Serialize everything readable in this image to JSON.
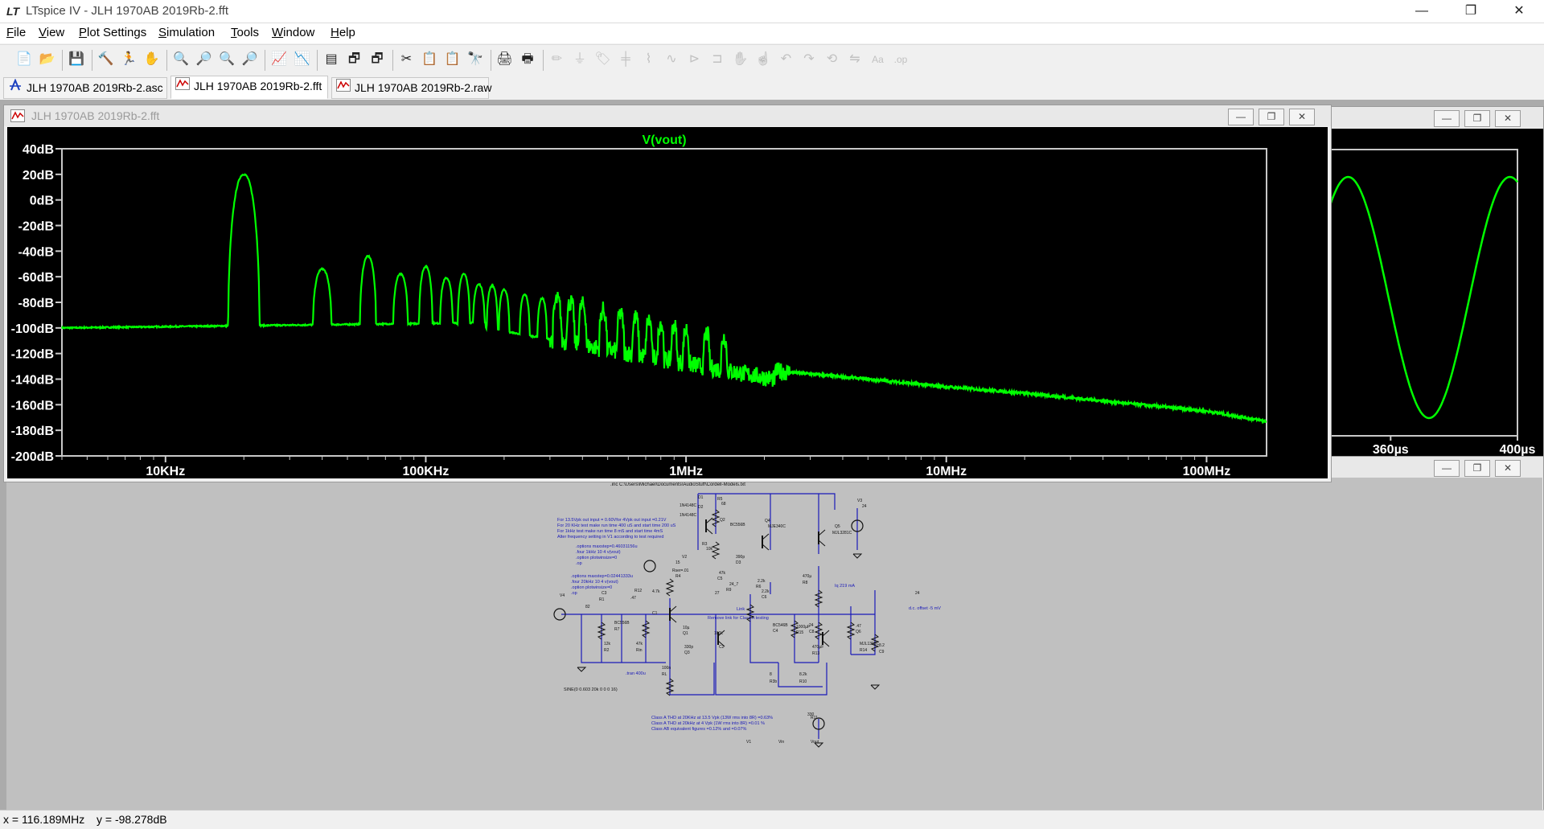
{
  "app": {
    "title": "LTspice IV - JLH 1970AB 2019Rb-2.fft",
    "logo_text": "LT",
    "window_controls": [
      "minimize",
      "restore",
      "close"
    ]
  },
  "menu": [
    {
      "label": "File",
      "underline": "F"
    },
    {
      "label": "View",
      "underline": "V"
    },
    {
      "label": "Plot Settings",
      "underline": "P"
    },
    {
      "label": "Simulation",
      "underline": "S"
    },
    {
      "label": "Tools",
      "underline": "T"
    },
    {
      "label": "Window",
      "underline": "W"
    },
    {
      "label": "Help",
      "underline": "H"
    }
  ],
  "toolbar": [
    {
      "icon": "new-schematic-icon",
      "glyph": "📄"
    },
    {
      "icon": "open-icon",
      "glyph": "📂"
    },
    {
      "sep": true
    },
    {
      "icon": "save-icon",
      "glyph": "💾"
    },
    {
      "sep": true
    },
    {
      "icon": "control-panel-icon",
      "glyph": "🔨"
    },
    {
      "icon": "run-icon",
      "glyph": "🏃"
    },
    {
      "icon": "pan-icon",
      "glyph": "✋"
    },
    {
      "sep": true
    },
    {
      "icon": "zoom-in-icon",
      "glyph": "🔍"
    },
    {
      "icon": "zoom-out-icon",
      "glyph": "🔎"
    },
    {
      "icon": "zoom-extents-icon",
      "glyph": "🔍"
    },
    {
      "icon": "zoom-cancel-icon",
      "glyph": "🔎"
    },
    {
      "sep": true
    },
    {
      "icon": "autorange-icon",
      "glyph": "📈"
    },
    {
      "icon": "probe-icon",
      "glyph": "📉"
    },
    {
      "sep": true
    },
    {
      "icon": "tile-horizontal-icon",
      "glyph": "▤"
    },
    {
      "icon": "cascade-icon",
      "glyph": "🗗"
    },
    {
      "icon": "tile-vertical-icon",
      "glyph": "🗗"
    },
    {
      "sep": true
    },
    {
      "icon": "cut-icon",
      "glyph": "✂"
    },
    {
      "icon": "copy-icon",
      "glyph": "📋"
    },
    {
      "icon": "paste-icon",
      "glyph": "📋"
    },
    {
      "icon": "find-icon",
      "glyph": "🔭"
    },
    {
      "sep": true
    },
    {
      "icon": "print-preview-icon",
      "glyph": "🖨"
    },
    {
      "icon": "print-icon",
      "glyph": "🖶"
    },
    {
      "sep": true
    },
    {
      "icon": "draw-wire-icon",
      "glyph": "✏"
    },
    {
      "icon": "ground-icon",
      "glyph": "⏚"
    },
    {
      "icon": "label-net-icon",
      "glyph": "🏷"
    },
    {
      "icon": "capacitor-icon",
      "glyph": "╪"
    },
    {
      "icon": "resistor-icon",
      "glyph": "⌇"
    },
    {
      "icon": "inductor-icon",
      "glyph": "∿"
    },
    {
      "icon": "diode-icon",
      "glyph": "⊳"
    },
    {
      "icon": "component-icon",
      "glyph": "⊐"
    },
    {
      "icon": "move-icon",
      "glyph": "✋"
    },
    {
      "icon": "drag-icon",
      "glyph": "☝"
    },
    {
      "icon": "undo-icon",
      "glyph": "↶"
    },
    {
      "icon": "redo-icon",
      "glyph": "↷"
    },
    {
      "icon": "rotate-icon",
      "glyph": "⟲"
    },
    {
      "icon": "mirror-icon",
      "glyph": "⇋"
    },
    {
      "icon": "text-icon",
      "glyph": "Aa"
    },
    {
      "icon": "spice-directive-icon",
      "glyph": ".op"
    }
  ],
  "tabs": [
    {
      "label": "JLH 1970AB 2019Rb-2.asc",
      "icon": "schematic-icon",
      "active": false
    },
    {
      "label": "JLH 1970AB 2019Rb-2.fft",
      "icon": "waveform-icon",
      "active": true
    },
    {
      "label": "JLH 1970AB 2019Rb-2.raw",
      "icon": "waveform-icon",
      "active": false
    }
  ],
  "fft_window": {
    "title": "JLH 1970AB 2019Rb-2.fft",
    "colors": {
      "trace": "#00ff00",
      "bg": "#000000",
      "axis": "#ffffff"
    }
  },
  "chart_data": [
    {
      "type": "line",
      "title": "V(vout)",
      "xlabel": "",
      "ylabel": "",
      "xscale": "log",
      "xlim": [
        4000,
        170000000
      ],
      "ylim": [
        -200,
        40
      ],
      "grid": false,
      "y_ticks": [
        "40dB",
        "20dB",
        "0dB",
        "-20dB",
        "-40dB",
        "-60dB",
        "-80dB",
        "-100dB",
        "-120dB",
        "-140dB",
        "-160dB",
        "-180dB",
        "-200dB"
      ],
      "x_ticks": [
        "10KHz",
        "100KHz",
        "1MHz",
        "10MHz",
        "100MHz"
      ],
      "series": [
        {
          "color": "#00ff00",
          "x": [
            4000,
            8000,
            15000,
            17000,
            20000,
            23000,
            26000,
            40000,
            60000,
            80000,
            100000,
            120000,
            140000,
            160000,
            180000,
            200000,
            300000,
            400000,
            600000,
            800000,
            1000000,
            1500000,
            2000000,
            3000000,
            5000000,
            10000000,
            20000000,
            50000000,
            100000000,
            170000000
          ],
          "values": [
            -102,
            -100,
            -97,
            15,
            20,
            15,
            -97,
            -56,
            -46,
            -62,
            -53,
            -65,
            -62,
            -71,
            -73,
            -75,
            -82,
            -88,
            -98,
            -102,
            -110,
            -125,
            -133,
            -136,
            -140,
            -146,
            -151,
            -159,
            -165,
            -173
          ],
          "peaks": [
            [
              20000,
              20
            ],
            [
              40000,
              -54
            ],
            [
              60000,
              -44
            ],
            [
              80000,
              -58
            ],
            [
              100000,
              -52
            ],
            [
              120000,
              -61
            ],
            [
              140000,
              -58
            ],
            [
              160000,
              -66
            ],
            [
              180000,
              -67
            ],
            [
              200000,
              -70
            ],
            [
              240000,
              -74
            ],
            [
              280000,
              -77
            ],
            [
              320000,
              -78
            ],
            [
              360000,
              -80
            ],
            [
              400000,
              -82
            ],
            [
              480000,
              -86
            ],
            [
              560000,
              -89
            ],
            [
              640000,
              -92
            ],
            [
              720000,
              -94
            ],
            [
              800000,
              -96
            ],
            [
              900000,
              -98
            ],
            [
              1000000,
              -101
            ],
            [
              1200000,
              -104
            ],
            [
              1400000,
              -107
            ]
          ]
        }
      ]
    },
    {
      "type": "line",
      "title": "",
      "xlabel": "",
      "ylabel": "",
      "xlim": [
        330,
        400
      ],
      "x_ticks": [
        "360µs",
        "400µs"
      ],
      "series": [
        {
          "color": "#00ff00",
          "x": [
            334,
            340,
            350,
            359,
            368,
            378,
            387,
            396,
            400
          ],
          "values": [
            0.0,
            0.55,
            0.97,
            1.0,
            0.55,
            -0.45,
            -0.98,
            -0.6,
            -0.1
          ]
        }
      ]
    }
  ],
  "schematic": {
    "title_line": ".inc C:\\Users\\Michael\\Documents\\AudioStuff\\Cordell-Models.txt",
    "notes": [
      "For 13.5Vpk out input = 0.60Vfor 4Vpk out input =0.21V",
      "For 20 KHz test make run time 400 uS and start time 200 uS",
      "For 1kHz test make run time 8 mS and start time 4mS",
      "Alter frequency setting in V1 according to test required",
      ".options maxstep=0.46031156u",
      ".four 1kHz 10 4 v(vout)",
      ".option plotwinsize=0",
      ".op",
      ".options maxstep=0.02441333u",
      ".four 20kHz 10 4 v(vout)",
      ".option plotwinsize=0",
      ".op",
      ".tran 400u",
      "SINE(0 0.603 20k 0 0 0 16)",
      "Remove link for Class A testing",
      "Link",
      "Iq 219 mA",
      "d.c. offset -5 mV",
      "Class A THD at 20KHz  at 13.5 Vpk (13W rms into 8R) =0.63%",
      "Class A THD at 20kHz  at  4  Vpk (1W rms into 8R) =0.01 %",
      "Class AB equivalent figures =0.12% and =0.07%"
    ],
    "parts": [
      "D1",
      "1N4148C",
      "D2",
      "1N4148C",
      "R5",
      "68",
      "Q2",
      "BC556B",
      "R3",
      "10k",
      "Q4",
      "MJE340C",
      "Q5",
      "MJL3281C",
      "V3",
      "24",
      "V2",
      "15",
      "Rser=.01",
      "R4",
      "47k",
      "C5",
      "390p",
      "D3",
      "24_7",
      "R9",
      "2.2k",
      "R6",
      "2.2k",
      "C6",
      "470µ",
      "R8",
      "27",
      "R12",
      ".47",
      "C3",
      "R1",
      "4.7k",
      "C1",
      "10µ",
      "Q1",
      "BC556B",
      "R7",
      "12k",
      "R2",
      "47k",
      "Rin",
      "100k",
      "C2",
      "330p",
      "Q3",
      "BC546B",
      "C4",
      "1000µF",
      "R15",
      "24",
      "C8",
      "470µF",
      "R13",
      ".47",
      "Q6",
      "MJL1302C",
      "R14",
      "8.2",
      "C9",
      "100n",
      "RL",
      "8",
      "R3b",
      "8.2k",
      "R10",
      "330",
      "R11",
      "82",
      "V4",
      "24",
      "V1",
      "Vin",
      "Vout"
    ]
  },
  "status": {
    "x": "x = 116.189MHz",
    "y": "y = -98.278dB"
  }
}
